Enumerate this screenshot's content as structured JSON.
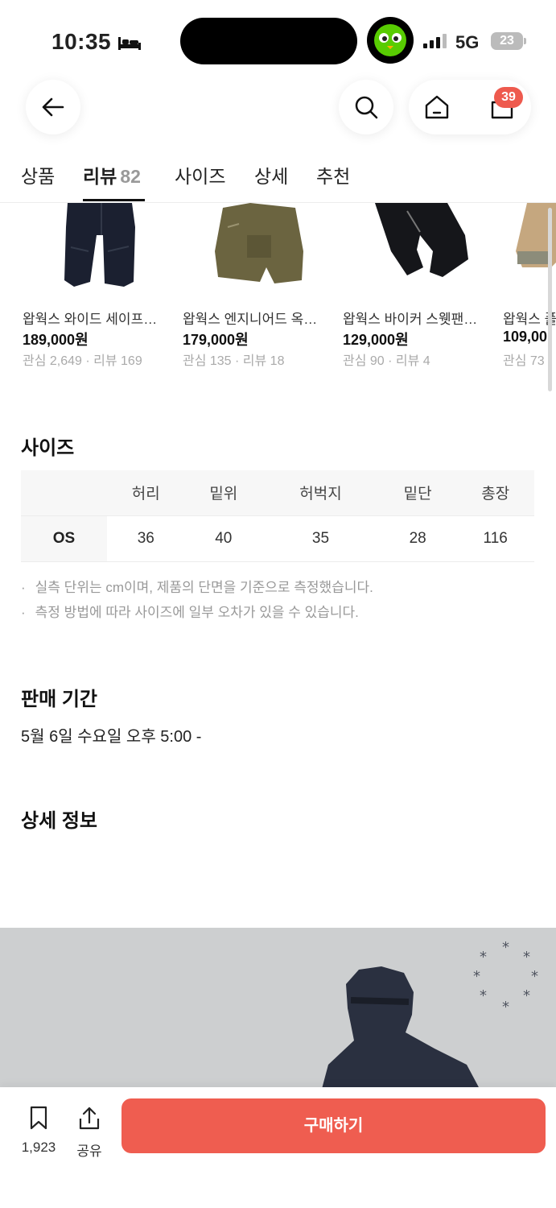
{
  "status_bar": {
    "time": "10:35",
    "network": "5G",
    "battery": "23"
  },
  "header": {
    "cart_count": "39"
  },
  "tabs": [
    {
      "label": "상품"
    },
    {
      "label": "리뷰",
      "count": "82"
    },
    {
      "label": "사이즈"
    },
    {
      "label": "상세"
    },
    {
      "label": "추천"
    }
  ],
  "products": [
    {
      "name": "왑웍스 와이드 세이프…",
      "price": "189,000원",
      "meta": "관심 2,649 · 리뷰 169"
    },
    {
      "name": "왑웍스 엔지니어드 옥…",
      "price": "179,000원",
      "meta": "관심 135 · 리뷰 18"
    },
    {
      "name": "왑웍스 바이커 스웻팬…",
      "price": "129,000원",
      "meta": "관심 90 · 리뷰 4"
    },
    {
      "name": "왑웍스 플",
      "price": "109,00",
      "meta": "관심 73 ·"
    }
  ],
  "size_section": {
    "title": "사이즈",
    "columns": [
      "허리",
      "밑위",
      "허벅지",
      "밑단",
      "총장"
    ],
    "rows": [
      {
        "label": "OS",
        "values": [
          "36",
          "40",
          "35",
          "28",
          "116"
        ]
      }
    ],
    "notes": [
      "실측 단위는 cm이며, 제품의 단면을 기준으로 측정했습니다.",
      "측정 방법에 따라 사이즈에 일부 오차가 있을 수 있습니다."
    ]
  },
  "sale_period": {
    "title": "판매 기간",
    "value": "5월 6일 수요일 오후 5:00 -"
  },
  "detail": {
    "title": "상세 정보"
  },
  "bottom_bar": {
    "bookmark_count": "1,923",
    "share_label": "공유",
    "buy_label": "구매하기"
  },
  "colors": {
    "accent": "#ef5d50",
    "badge": "#ee5a4e"
  }
}
